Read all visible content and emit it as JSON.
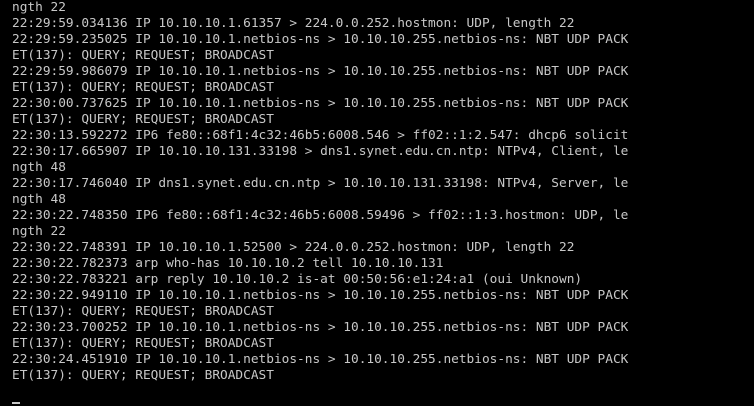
{
  "terminal": {
    "colors": {
      "background": "#000000",
      "text": "#c8c8c8"
    },
    "lines": [
      "ngth 22",
      "22:29:59.034136 IP 10.10.10.1.61357 > 224.0.0.252.hostmon: UDP, length 22",
      "22:29:59.235025 IP 10.10.10.1.netbios-ns > 10.10.10.255.netbios-ns: NBT UDP PACK",
      "ET(137): QUERY; REQUEST; BROADCAST",
      "22:29:59.986079 IP 10.10.10.1.netbios-ns > 10.10.10.255.netbios-ns: NBT UDP PACK",
      "ET(137): QUERY; REQUEST; BROADCAST",
      "22:30:00.737625 IP 10.10.10.1.netbios-ns > 10.10.10.255.netbios-ns: NBT UDP PACK",
      "ET(137): QUERY; REQUEST; BROADCAST",
      "22:30:13.592272 IP6 fe80::68f1:4c32:46b5:6008.546 > ff02::1:2.547: dhcp6 solicit",
      "22:30:17.665907 IP 10.10.10.131.33198 > dns1.synet.edu.cn.ntp: NTPv4, Client, le",
      "ngth 48",
      "22:30:17.746040 IP dns1.synet.edu.cn.ntp > 10.10.10.131.33198: NTPv4, Server, le",
      "ngth 48",
      "22:30:22.748350 IP6 fe80::68f1:4c32:46b5:6008.59496 > ff02::1:3.hostmon: UDP, le",
      "ngth 22",
      "22:30:22.748391 IP 10.10.10.1.52500 > 224.0.0.252.hostmon: UDP, length 22",
      "22:30:22.782373 arp who-has 10.10.10.2 tell 10.10.10.131",
      "22:30:22.783221 arp reply 10.10.10.2 is-at 00:50:56:e1:24:a1 (oui Unknown)",
      "22:30:22.949110 IP 10.10.10.1.netbios-ns > 10.10.10.255.netbios-ns: NBT UDP PACK",
      "ET(137): QUERY; REQUEST; BROADCAST",
      "22:30:23.700252 IP 10.10.10.1.netbios-ns > 10.10.10.255.netbios-ns: NBT UDP PACK",
      "ET(137): QUERY; REQUEST; BROADCAST",
      "22:30:24.451910 IP 10.10.10.1.netbios-ns > 10.10.10.255.netbios-ns: NBT UDP PACK",
      "ET(137): QUERY; REQUEST; BROADCAST"
    ]
  }
}
